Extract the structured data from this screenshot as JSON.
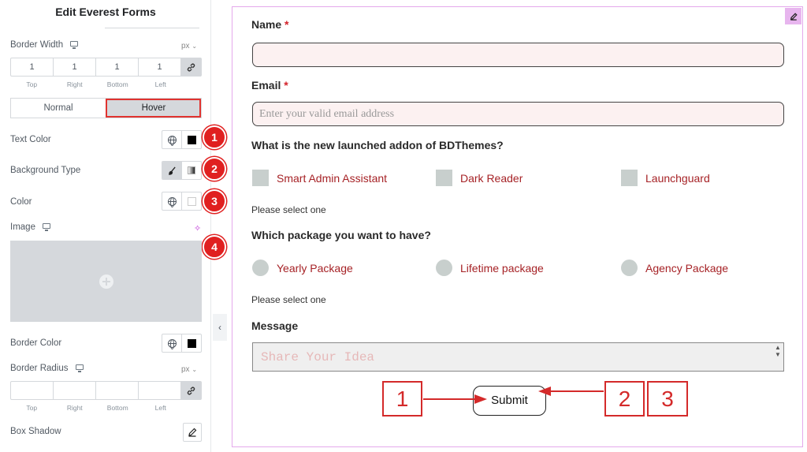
{
  "panel": {
    "title": "Edit Everest Forms",
    "border_width": {
      "label": "Border Width",
      "unit": "px",
      "values": [
        "1",
        "1",
        "1",
        "1"
      ],
      "captions": [
        "Top",
        "Right",
        "Bottom",
        "Left"
      ]
    },
    "tabs": {
      "normal": "Normal",
      "hover": "Hover",
      "active": "Hover"
    },
    "text_color": {
      "label": "Text Color",
      "value": "#000000"
    },
    "background_type": {
      "label": "Background Type"
    },
    "color": {
      "label": "Color",
      "value": "#ffffff"
    },
    "image": {
      "label": "Image"
    },
    "border_color": {
      "label": "Border Color",
      "value": "#000000"
    },
    "border_radius": {
      "label": "Border Radius",
      "unit": "px",
      "values": [
        "",
        "",
        "",
        ""
      ],
      "captions": [
        "Top",
        "Right",
        "Bottom",
        "Left"
      ]
    },
    "box_shadow": {
      "label": "Box Shadow"
    },
    "badges": [
      "1",
      "2",
      "3",
      "4"
    ]
  },
  "form": {
    "name_label": "Name",
    "required_mark": "*",
    "email_label": "Email",
    "email_placeholder": "Enter your valid email address",
    "addon_question": "What is the new launched addon of BDThemes?",
    "addon_options": [
      "Smart Admin Assistant",
      "Dark Reader",
      "Launchguard"
    ],
    "addon_help": "Please select one",
    "package_question": "Which package you want to have?",
    "package_options": [
      "Yearly Package",
      "Lifetime package",
      "Agency Package"
    ],
    "package_help": "Please select one",
    "message_label": "Message",
    "message_placeholder": "Share Your Idea",
    "submit_label": "Submit"
  },
  "callouts": [
    "1",
    "2",
    "3"
  ],
  "colors": {
    "accent_red": "#e02020",
    "frame_pink": "#e4a9ec",
    "option_text": "#a62226"
  }
}
